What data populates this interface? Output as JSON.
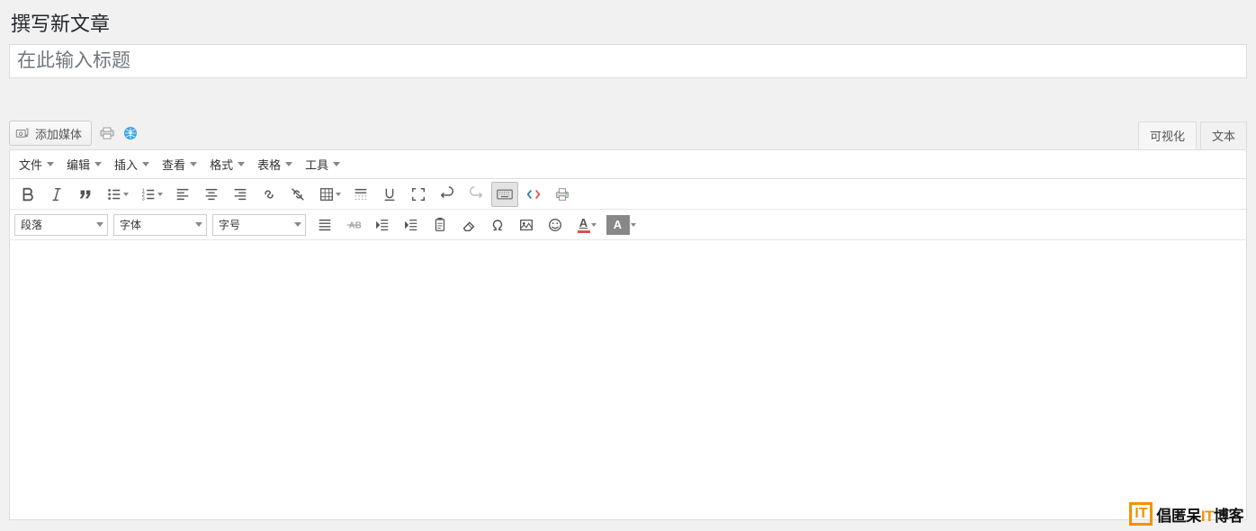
{
  "page": {
    "heading": "撰写新文章",
    "title_placeholder": "在此输入标题"
  },
  "media": {
    "add_label": "添加媒体"
  },
  "tabs": {
    "visual": "可视化",
    "text": "文本"
  },
  "menubar": [
    {
      "label": "文件"
    },
    {
      "label": "编辑"
    },
    {
      "label": "插入"
    },
    {
      "label": "查看"
    },
    {
      "label": "格式"
    },
    {
      "label": "表格"
    },
    {
      "label": "工具"
    }
  ],
  "toolbar_row1_icons": [
    "bold",
    "italic",
    "blockquote",
    "bullet-list",
    "numbered-list",
    "align-left",
    "align-center",
    "align-right",
    "link",
    "unlink",
    "table",
    "more",
    "underline",
    "fullscreen",
    "undo",
    "redo",
    "keyboard",
    "code",
    "print"
  ],
  "dropdowns": {
    "paragraph": "段落",
    "font_family": "字体",
    "font_size": "字号"
  },
  "toolbar_row2_icons": [
    "align-justify",
    "strikethrough",
    "outdent",
    "indent",
    "paste",
    "eraser",
    "omega",
    "image",
    "smiley",
    "text-color",
    "bg-color"
  ],
  "watermark": {
    "logo_letter": "IT",
    "text_prefix": "倡匿呆",
    "text_orange": "IT",
    "text_suffix": "博客"
  }
}
